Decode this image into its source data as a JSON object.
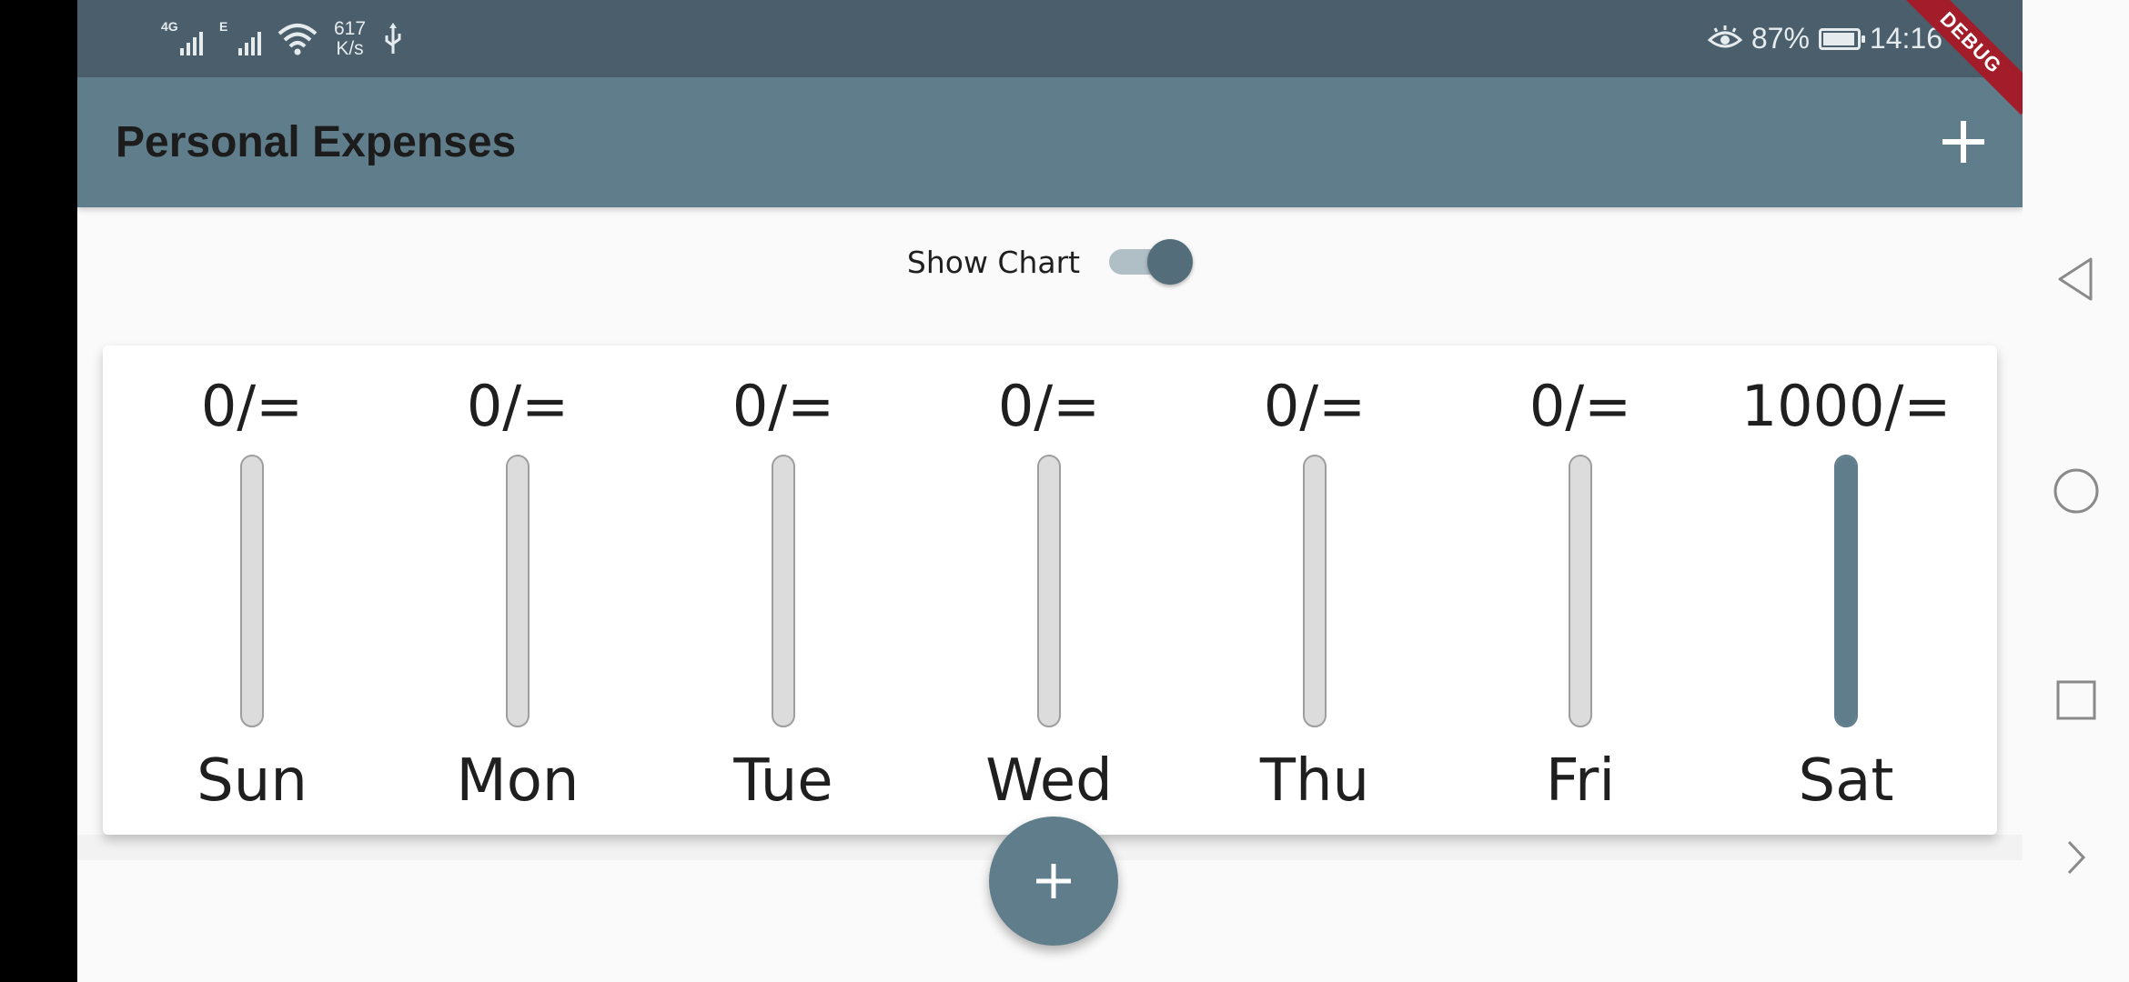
{
  "status_bar": {
    "network_1": "4G",
    "network_2": "E",
    "speed_value": "617",
    "speed_unit": "K/s",
    "battery": "87%",
    "time": "14:16"
  },
  "debug_banner": "DEBUG",
  "app_bar": {
    "title": "Personal Expenses",
    "add_icon": "plus-icon"
  },
  "chart_toggle": {
    "label": "Show Chart",
    "on": true
  },
  "chart_data": {
    "type": "bar",
    "categories": [
      "Sun",
      "Mon",
      "Tue",
      "Wed",
      "Thu",
      "Fri",
      "Sat"
    ],
    "value_labels": [
      "0/=",
      "0/=",
      "0/=",
      "0/=",
      "0/=",
      "0/=",
      "1000/="
    ],
    "values": [
      0,
      0,
      0,
      0,
      0,
      0,
      1000
    ],
    "fill_fraction": [
      0,
      0,
      0,
      0,
      0,
      0,
      1.0
    ],
    "bar_color": "#607d8b",
    "empty_color": "#dcdcdc"
  },
  "fab": {
    "icon": "plus-icon"
  },
  "system_nav": {
    "back": "back-triangle-icon",
    "home": "home-circle-icon",
    "recents": "recents-square-icon",
    "expand": "chevron-right-icon"
  }
}
